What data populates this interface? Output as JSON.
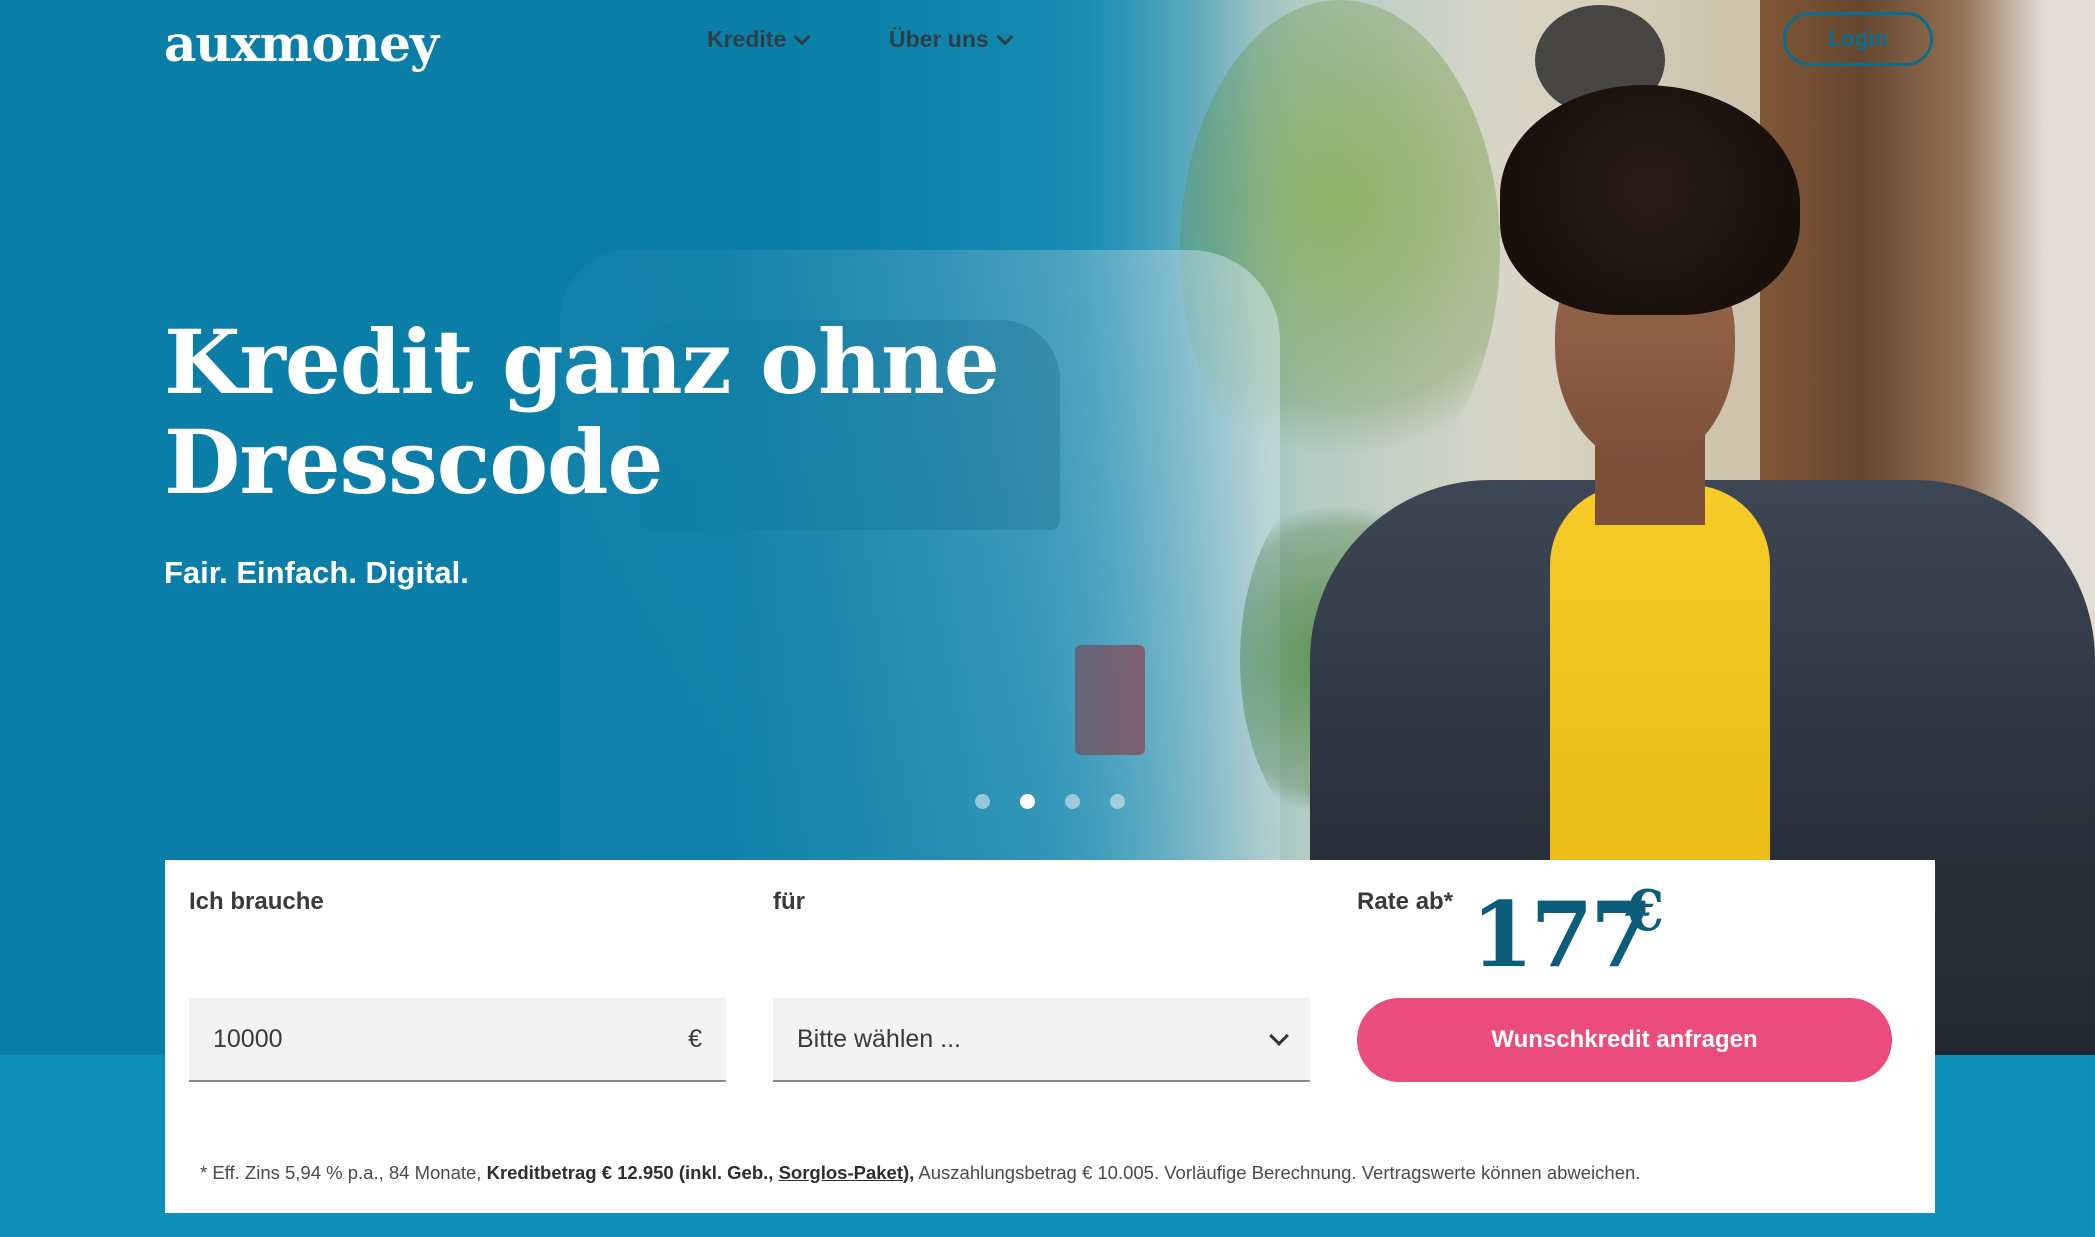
{
  "brand": {
    "logo_text": "auxmoney",
    "accent": "#e94c7d",
    "primary": "#0c86b0",
    "dark_blue": "#0c5d7a"
  },
  "nav": {
    "items": [
      {
        "label": "Kredite",
        "icon": "chevron-down-icon"
      },
      {
        "label": "Über uns",
        "icon": "chevron-down-icon"
      }
    ],
    "login_label": "Login"
  },
  "hero": {
    "headline_line1": "Kredit ganz ohne",
    "headline_line2": "Dresscode",
    "subline": "Fair. Einfach. Digital.",
    "carousel": {
      "slides": 4,
      "active_index": 1
    }
  },
  "calculator": {
    "amount_label": "Ich brauche",
    "amount_value": "10000",
    "amount_currency": "€",
    "purpose_label": "für",
    "purpose_value": "Bitte wählen ...",
    "rate_label": "Rate ab*",
    "rate_value": "177",
    "rate_currency": "€",
    "cta_label": "Wunschkredit anfragen",
    "footnote": {
      "part1": "* Eff. Zins 5,94 % p.a., 84 Monate, ",
      "bold1": "Kreditbetrag € 12.950 (inkl. Geb., ",
      "link": "Sorglos-Paket",
      "bold2": "),",
      "part2": " Auszahlungsbetrag € 10.005. Vorläufige Berechnung. Vertragswerte können abweichen."
    }
  }
}
